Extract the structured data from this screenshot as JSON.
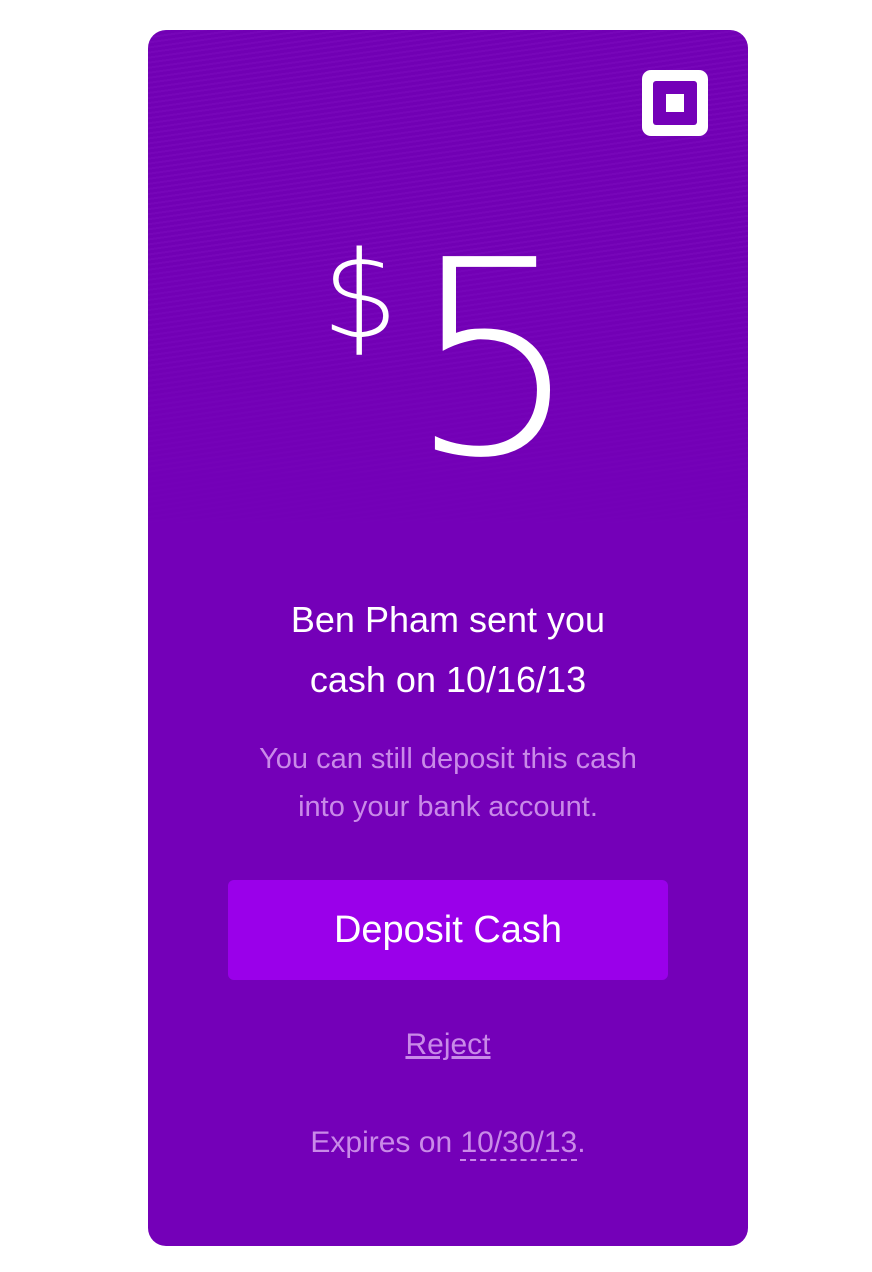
{
  "card": {
    "background": "#7400b8",
    "logo_icon": "square-logo-icon",
    "currency_symbol": "$",
    "amount": "5",
    "headline_line1": "Ben Pham sent you",
    "headline_line2": "cash on 10/16/13",
    "subtext_line1": "You can still deposit this cash",
    "subtext_line2": "into your bank account.",
    "deposit_button_label": "Deposit Cash",
    "deposit_button_color": "#9a00ea",
    "reject_label": "Reject",
    "expires_prefix": "Expires on ",
    "expires_date": "10/30/13",
    "expires_suffix": "."
  }
}
